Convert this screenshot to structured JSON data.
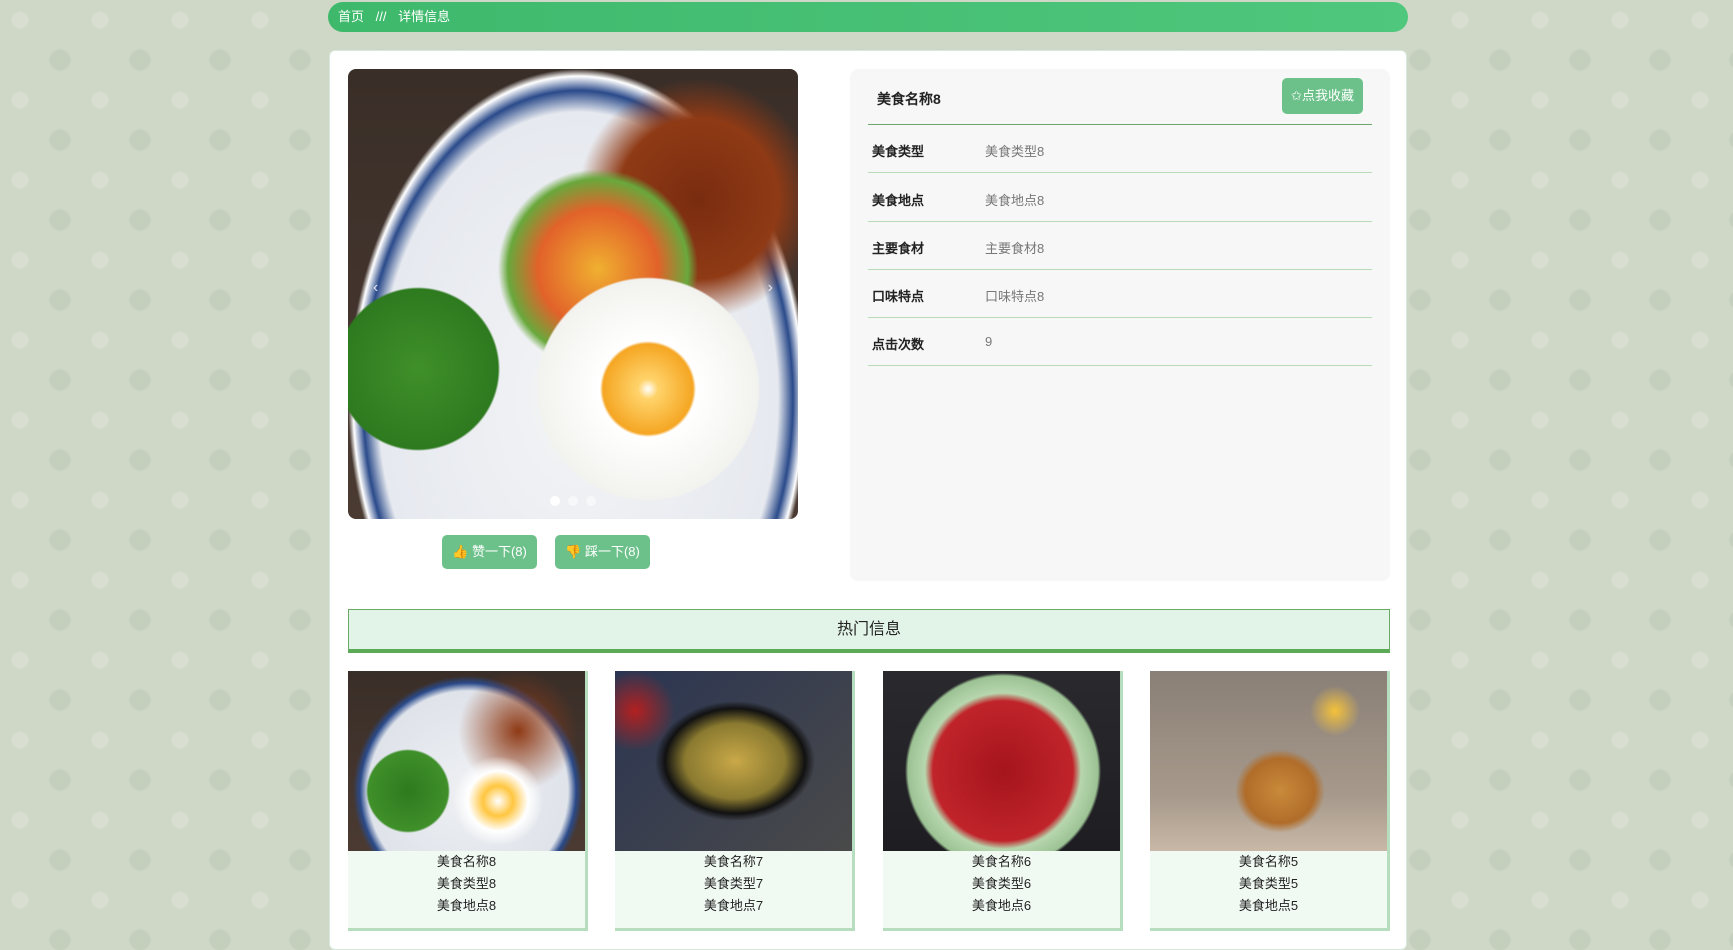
{
  "breadcrumb": {
    "home": "首页",
    "sep": "///",
    "current": "详情信息"
  },
  "carousel": {
    "prev": "‹",
    "next": "›",
    "slides": 3,
    "active": 0
  },
  "actions": {
    "like": "👍 赞一下(8)",
    "dislike": "👎 踩一下(8)"
  },
  "detail": {
    "title": "美食名称8",
    "favorite": "✩点我收藏",
    "rows": [
      {
        "k": "美食类型",
        "v": "美食类型8"
      },
      {
        "k": "美食地点",
        "v": "美食地点8"
      },
      {
        "k": "主要食材",
        "v": "主要食材8"
      },
      {
        "k": "口味特点",
        "v": "口味特点8"
      },
      {
        "k": "点击次数",
        "v": "9"
      }
    ]
  },
  "hot": {
    "title": "热门信息",
    "items": [
      {
        "name": "美食名称8",
        "type": "美食类型8",
        "place": "美食地点8"
      },
      {
        "name": "美食名称7",
        "type": "美食类型7",
        "place": "美食地点7"
      },
      {
        "name": "美食名称6",
        "type": "美食类型6",
        "place": "美食地点6"
      },
      {
        "name": "美食名称5",
        "type": "美食类型5",
        "place": "美食地点5"
      }
    ]
  },
  "colors": {
    "accent": "#45bf72",
    "button": "#6cc18a"
  }
}
